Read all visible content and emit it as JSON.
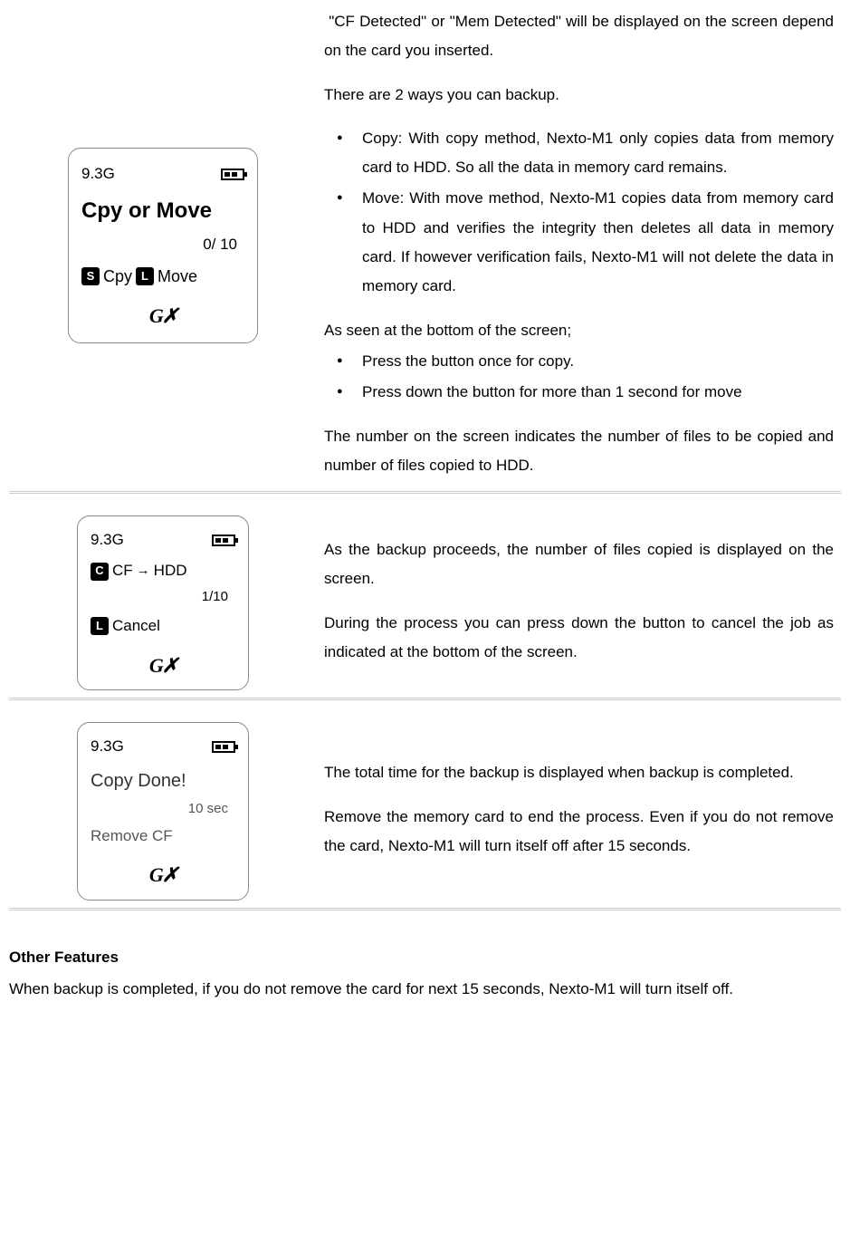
{
  "row1": {
    "screen": {
      "size": "9.3G",
      "title": "Cpy or Move",
      "counter": "0/ 10",
      "key1": "S",
      "label1": "Cpy",
      "key2": "L",
      "label2": "Move"
    },
    "p1": " \"CF Detected\" or \"Mem Detected\" will be displayed on the screen depend on the card you inserted.",
    "p2": "There are 2 ways you can backup.",
    "li1": "Copy: With copy method, Nexto-M1 only copies data from memory card to HDD. So all the data in memory card remains.",
    "li2": "Move: With move method, Nexto-M1 copies data from memory card to HDD and verifies the integrity then deletes all data in memory card. If however verification fails, Nexto-M1 will not delete the data in memory card.",
    "p3": "As seen at the bottom of the screen;",
    "li3": "Press the button once for copy.",
    "li4": "Press down the button for more than 1 second for move",
    "p4": "The number on the screen indicates the number of files to be copied and number of files copied to HDD."
  },
  "row2": {
    "screen": {
      "size": "9.3G",
      "key1": "C",
      "src": "CF",
      "arrow": "→",
      "dst": "HDD",
      "counter": "1/10",
      "key2": "L",
      "label2": "Cancel"
    },
    "p1": "As the backup proceeds, the number of files copied is displayed on the screen.",
    "p2": "During the process you can press down the button to cancel the job as indicated at the bottom of the screen."
  },
  "row3": {
    "screen": {
      "size": "9.3G",
      "title": "Copy Done!",
      "time": "10 sec",
      "msg": "Remove CF"
    },
    "p1": "The total time for the backup is displayed when backup is completed.",
    "p2": "Remove the memory card to end the process. Even if you do not remove the card, Nexto-M1 will turn itself off after 15 seconds."
  },
  "footer": {
    "heading": "Other Features",
    "text": "When backup is completed, if you do not remove the card for next 15 seconds, Nexto-M1 will turn itself off."
  },
  "logo": "G✗"
}
